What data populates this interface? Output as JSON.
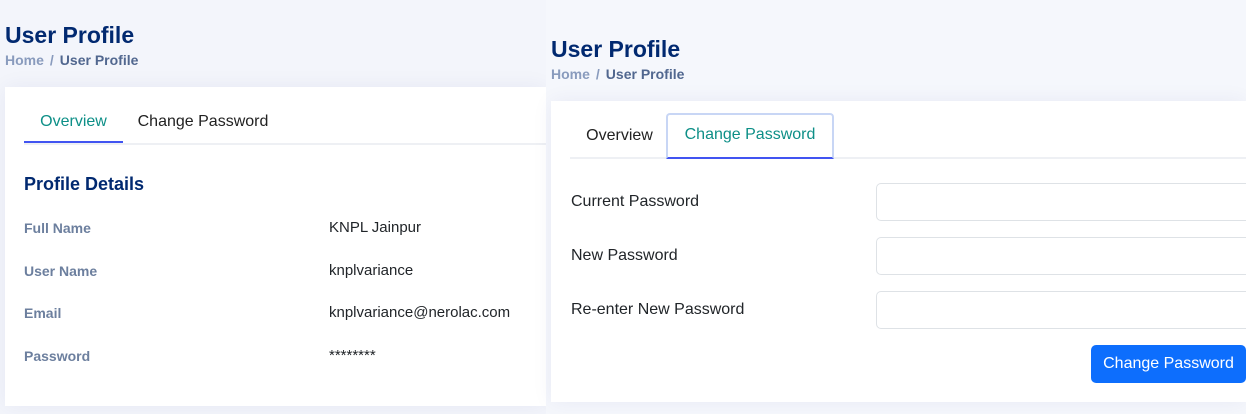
{
  "left": {
    "page_title": "User Profile",
    "breadcrumb": {
      "home": "Home",
      "separator": "/",
      "current": "User Profile"
    },
    "tabs": [
      {
        "label": "Overview",
        "active": true
      },
      {
        "label": "Change Password",
        "active": false
      }
    ],
    "section_title": "Profile Details",
    "details": [
      {
        "label": "Full Name",
        "value": "KNPL Jainpur"
      },
      {
        "label": "User Name",
        "value": "knplvariance"
      },
      {
        "label": "Email",
        "value": "knplvariance@nerolac.com"
      },
      {
        "label": "Password",
        "value": "********"
      }
    ]
  },
  "right": {
    "page_title": "User Profile",
    "breadcrumb": {
      "home": "Home",
      "separator": "/",
      "current": "User Profile"
    },
    "tabs": [
      {
        "label": "Overview",
        "active": false
      },
      {
        "label": "Change Password",
        "active": true
      }
    ],
    "form": {
      "current_password": {
        "label": "Current Password",
        "value": "",
        "placeholder": ""
      },
      "new_password": {
        "label": "New Password",
        "value": "",
        "placeholder": ""
      },
      "reenter_password": {
        "label": "Re-enter New Password",
        "value": "",
        "placeholder": ""
      },
      "submit_label": "Change Password"
    }
  },
  "colors": {
    "heading": "#012970",
    "tab_active_text": "#0d8f87",
    "tab_underline": "#4154f1",
    "primary_button": "#0d6efd",
    "breadcrumb": "#899bbd"
  }
}
